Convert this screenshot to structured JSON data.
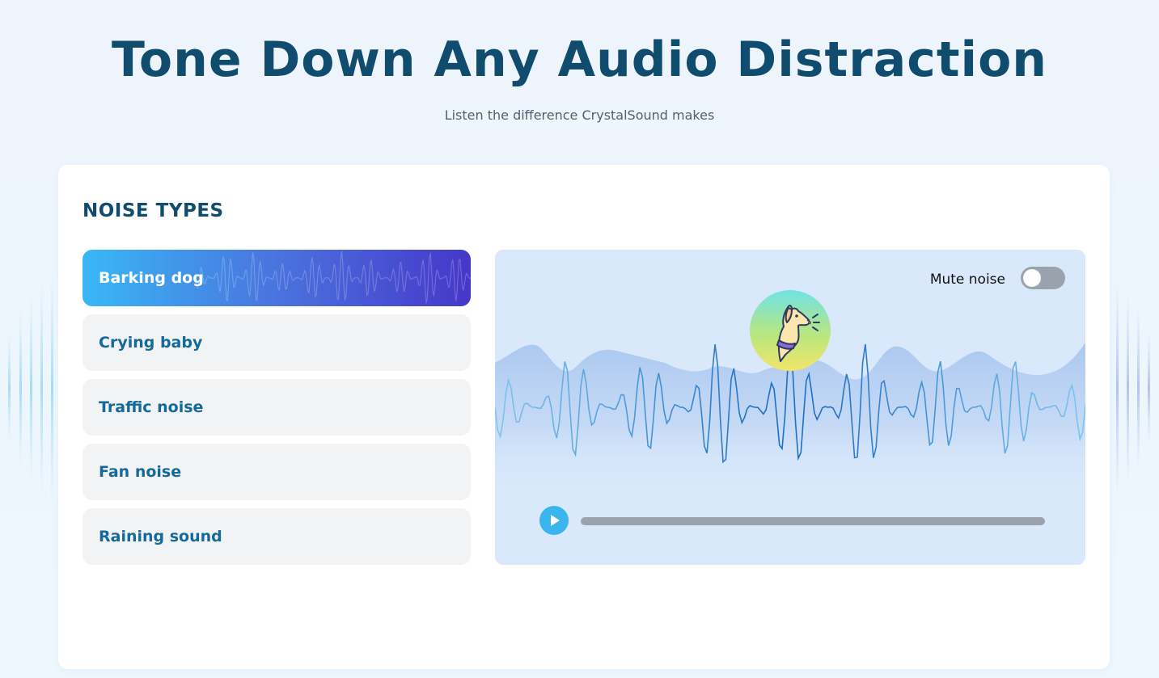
{
  "hero": {
    "title": "Tone Down Any Audio Distraction",
    "subtitle": "Listen the difference CrystalSound makes"
  },
  "noise_section": {
    "title": "NOISE TYPES",
    "items": [
      {
        "label": "Barking dog",
        "active": true
      },
      {
        "label": "Crying baby",
        "active": false
      },
      {
        "label": "Traffic noise",
        "active": false
      },
      {
        "label": "Fan noise",
        "active": false
      },
      {
        "label": "Raining sound",
        "active": false
      }
    ]
  },
  "player": {
    "mute_label": "Mute noise",
    "mute_on": false,
    "avatar_icon": "barking-dog-icon",
    "play_icon": "play-icon",
    "progress": 0
  },
  "colors": {
    "title": "#0f4c6e",
    "accent": "#3bb5ee",
    "active_gradient_start": "#39b8f5",
    "active_gradient_end": "#4637c9",
    "item_text": "#146a9a",
    "player_bg": "#d9e8fb"
  }
}
